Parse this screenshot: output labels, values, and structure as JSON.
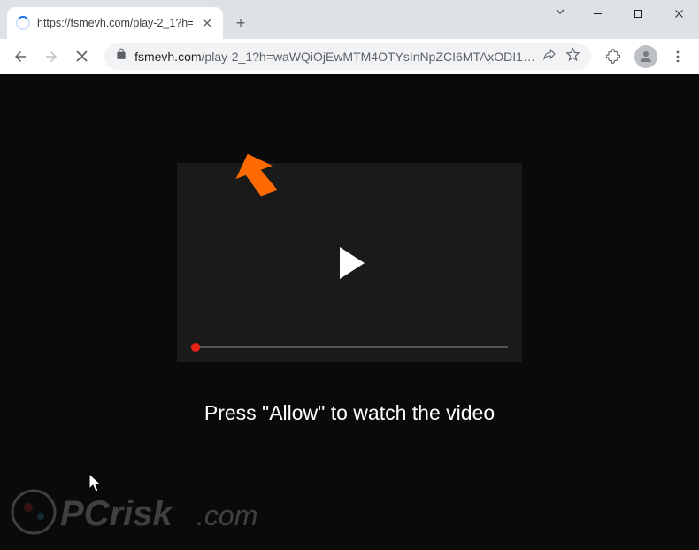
{
  "browser": {
    "tab": {
      "title": "https://fsmevh.com/play-2_1?h="
    },
    "url_domain": "fsmevh.com",
    "url_path": "/play-2_1?h=waWQiOjEwMTM4OTYsInNpZCI6MTAxODI1…"
  },
  "page": {
    "prompt": "Press \"Allow\" to watch the video"
  },
  "watermark": {
    "text": "PCrisk.com"
  }
}
